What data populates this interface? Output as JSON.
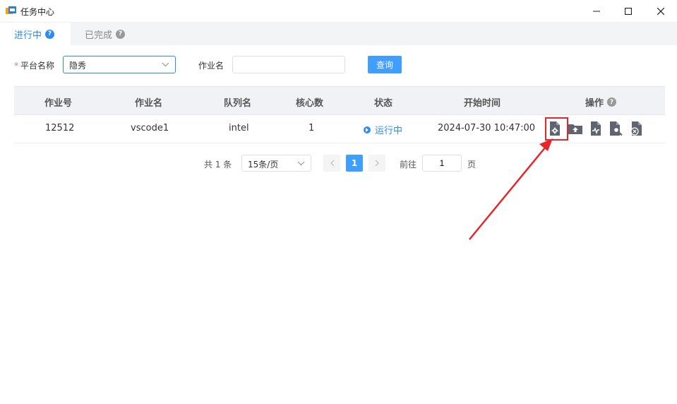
{
  "window": {
    "title": "任务中心",
    "controls": [
      "minimize",
      "maximize",
      "close"
    ]
  },
  "tabs": [
    {
      "label": "进行中",
      "active": true
    },
    {
      "label": "已完成",
      "active": false
    }
  ],
  "filters": {
    "platform_label": "平台名称",
    "platform_value": "隐秀",
    "job_label": "作业名",
    "job_value": "",
    "query_label": "查询"
  },
  "table": {
    "headers": [
      "作业号",
      "作业名",
      "队列名",
      "核心数",
      "状态",
      "开始时间",
      "操作"
    ],
    "rows": [
      {
        "job_id": "12512",
        "job_name": "vscode1",
        "queue": "intel",
        "cores": "1",
        "status": "运行中",
        "start_time": "2024-07-30 10:47:00"
      }
    ],
    "row_actions": [
      "file-settings-icon",
      "folder-upload-icon",
      "file-monitor-icon",
      "file-search-icon",
      "file-cancel-icon"
    ]
  },
  "pagination": {
    "total_text": "共 1 条",
    "page_size": "15条/页",
    "current_page": "1",
    "goto_label": "前往",
    "goto_value": "1",
    "page_suffix": "页"
  },
  "colors": {
    "accent": "#409eff",
    "tab_active": "#2d8cf0",
    "highlight": "#e8262a"
  }
}
